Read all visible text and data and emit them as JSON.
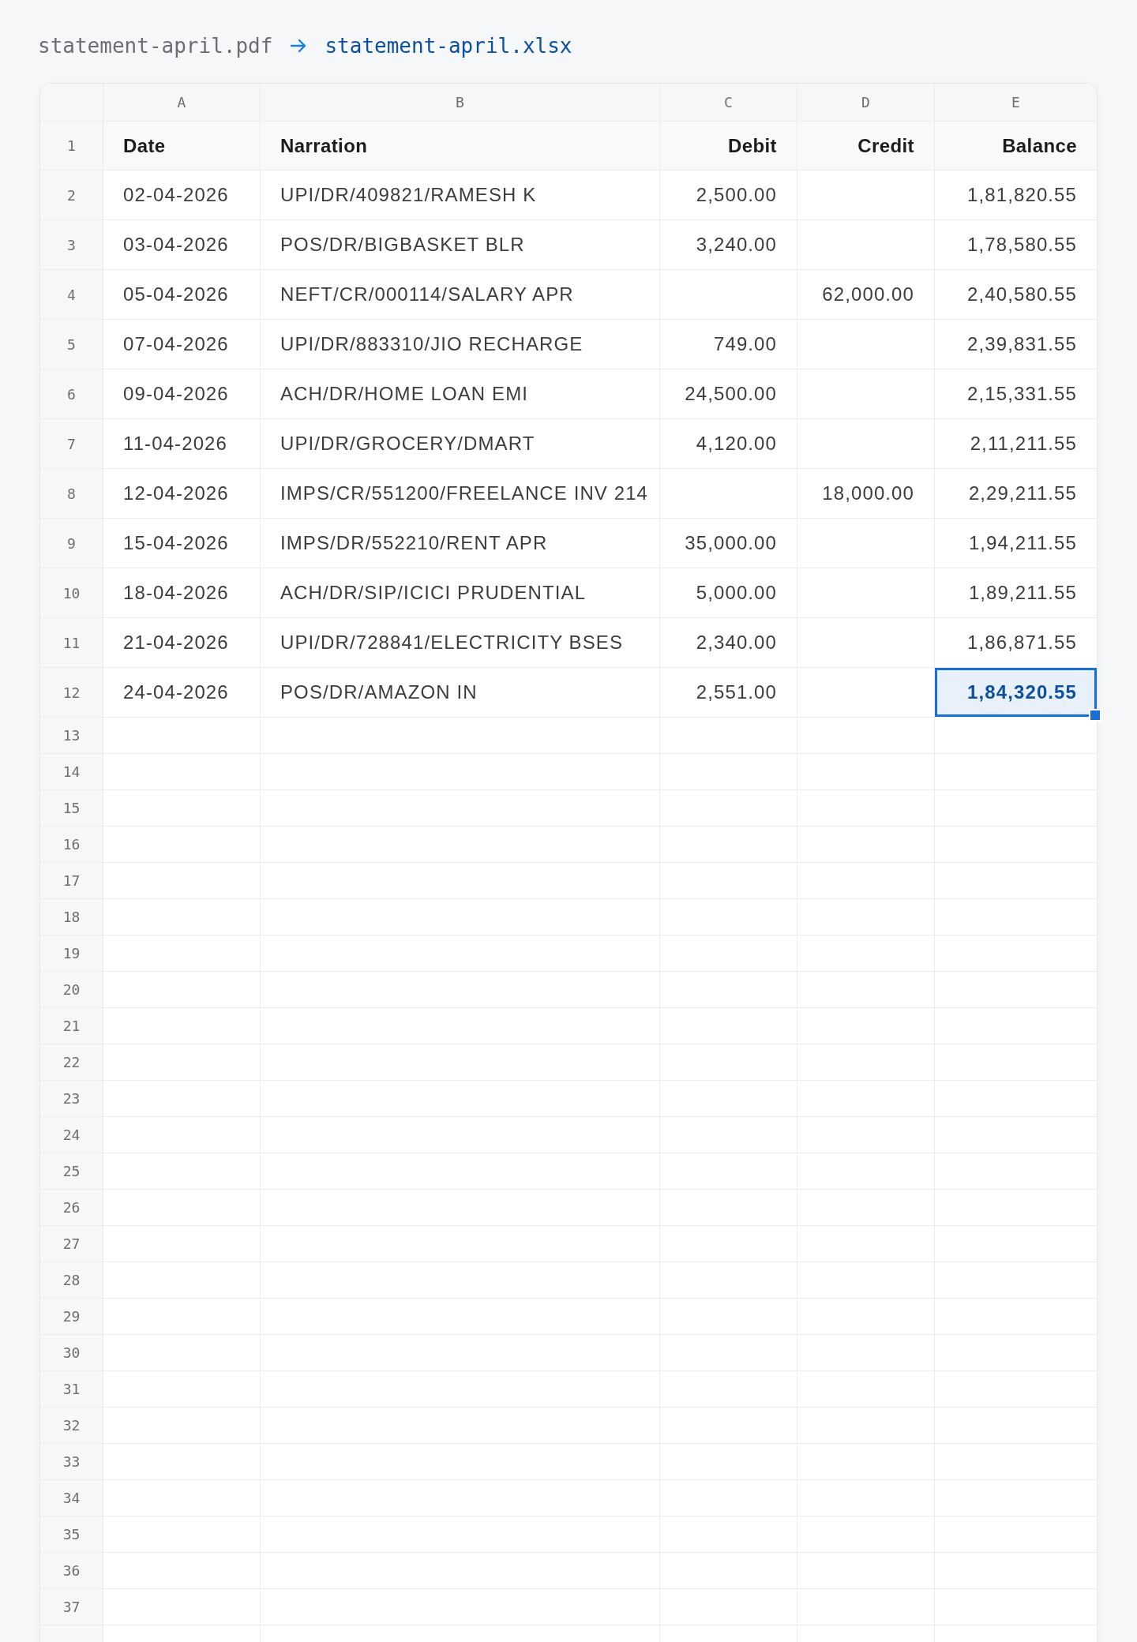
{
  "conversion": {
    "source": "statement-april.pdf",
    "target": "statement-april.xlsx"
  },
  "sheet": {
    "columns": [
      {
        "letter": "A",
        "kind": "text"
      },
      {
        "letter": "B",
        "kind": "text"
      },
      {
        "letter": "C",
        "kind": "number"
      },
      {
        "letter": "D",
        "kind": "number"
      },
      {
        "letter": "E",
        "kind": "number"
      }
    ],
    "header_row": {
      "number": "1",
      "cells": [
        "Date",
        "Narration",
        "Debit",
        "Credit",
        "Balance"
      ]
    },
    "rows": [
      {
        "number": "2",
        "cells": [
          {
            "text": "02-04-2026",
            "selected": false
          },
          {
            "text": "UPI/DR/409821/RAMESH K",
            "selected": false
          },
          {
            "text": "2,500.00",
            "selected": false
          },
          {
            "selected": false
          },
          {
            "text": "1,81,820.55",
            "selected": false
          }
        ]
      },
      {
        "number": "3",
        "cells": [
          {
            "text": "03-04-2026",
            "selected": false
          },
          {
            "text": "POS/DR/BIGBASKET BLR",
            "selected": false
          },
          {
            "text": "3,240.00",
            "selected": false
          },
          {
            "selected": false
          },
          {
            "text": "1,78,580.55",
            "selected": false
          }
        ]
      },
      {
        "number": "4",
        "cells": [
          {
            "text": "05-04-2026",
            "selected": false
          },
          {
            "text": "NEFT/CR/000114/SALARY APR",
            "selected": false
          },
          {
            "selected": false
          },
          {
            "text": "62,000.00",
            "selected": false
          },
          {
            "text": "2,40,580.55",
            "selected": false
          }
        ]
      },
      {
        "number": "5",
        "cells": [
          {
            "text": "07-04-2026",
            "selected": false
          },
          {
            "text": "UPI/DR/883310/JIO RECHARGE",
            "selected": false
          },
          {
            "text": "749.00",
            "selected": false
          },
          {
            "selected": false
          },
          {
            "text": "2,39,831.55",
            "selected": false
          }
        ]
      },
      {
        "number": "6",
        "cells": [
          {
            "text": "09-04-2026",
            "selected": false
          },
          {
            "text": "ACH/DR/HOME LOAN EMI",
            "selected": false
          },
          {
            "text": "24,500.00",
            "selected": false
          },
          {
            "selected": false
          },
          {
            "text": "2,15,331.55",
            "selected": false
          }
        ]
      },
      {
        "number": "7",
        "cells": [
          {
            "text": "11-04-2026",
            "selected": false
          },
          {
            "text": "UPI/DR/GROCERY/DMART",
            "selected": false
          },
          {
            "text": "4,120.00",
            "selected": false
          },
          {
            "selected": false
          },
          {
            "text": "2,11,211.55",
            "selected": false
          }
        ]
      },
      {
        "number": "8",
        "cells": [
          {
            "text": "12-04-2026",
            "selected": false
          },
          {
            "text": "IMPS/CR/551200/FREELANCE INV 214",
            "selected": false
          },
          {
            "selected": false
          },
          {
            "text": "18,000.00",
            "selected": false
          },
          {
            "text": "2,29,211.55",
            "selected": false
          }
        ]
      },
      {
        "number": "9",
        "cells": [
          {
            "text": "15-04-2026",
            "selected": false
          },
          {
            "text": "IMPS/DR/552210/RENT APR",
            "selected": false
          },
          {
            "text": "35,000.00",
            "selected": false
          },
          {
            "selected": false
          },
          {
            "text": "1,94,211.55",
            "selected": false
          }
        ]
      },
      {
        "number": "10",
        "cells": [
          {
            "text": "18-04-2026",
            "selected": false
          },
          {
            "text": "ACH/DR/SIP/ICICI PRUDENTIAL",
            "selected": false
          },
          {
            "text": "5,000.00",
            "selected": false
          },
          {
            "selected": false
          },
          {
            "text": "1,89,211.55",
            "selected": false
          }
        ]
      },
      {
        "number": "11",
        "cells": [
          {
            "text": "21-04-2026",
            "selected": false
          },
          {
            "text": "UPI/DR/728841/ELECTRICITY BSES",
            "selected": false
          },
          {
            "text": "2,340.00",
            "selected": false
          },
          {
            "selected": false
          },
          {
            "text": "1,86,871.55",
            "selected": false
          }
        ]
      },
      {
        "number": "12",
        "cells": [
          {
            "text": "24-04-2026",
            "selected": false
          },
          {
            "text": "POS/DR/AMAZON IN",
            "selected": false
          },
          {
            "text": "2,551.00",
            "selected": false
          },
          {
            "selected": false
          },
          {
            "text": "1,84,320.55",
            "selected": true
          }
        ]
      }
    ],
    "empty_rows": [
      "13",
      "14",
      "15",
      "16",
      "17",
      "18",
      "19",
      "20",
      "21",
      "22",
      "23",
      "24",
      "25",
      "26",
      "27",
      "28",
      "29",
      "30",
      "31",
      "32",
      "33",
      "34",
      "35",
      "36",
      "37"
    ]
  }
}
